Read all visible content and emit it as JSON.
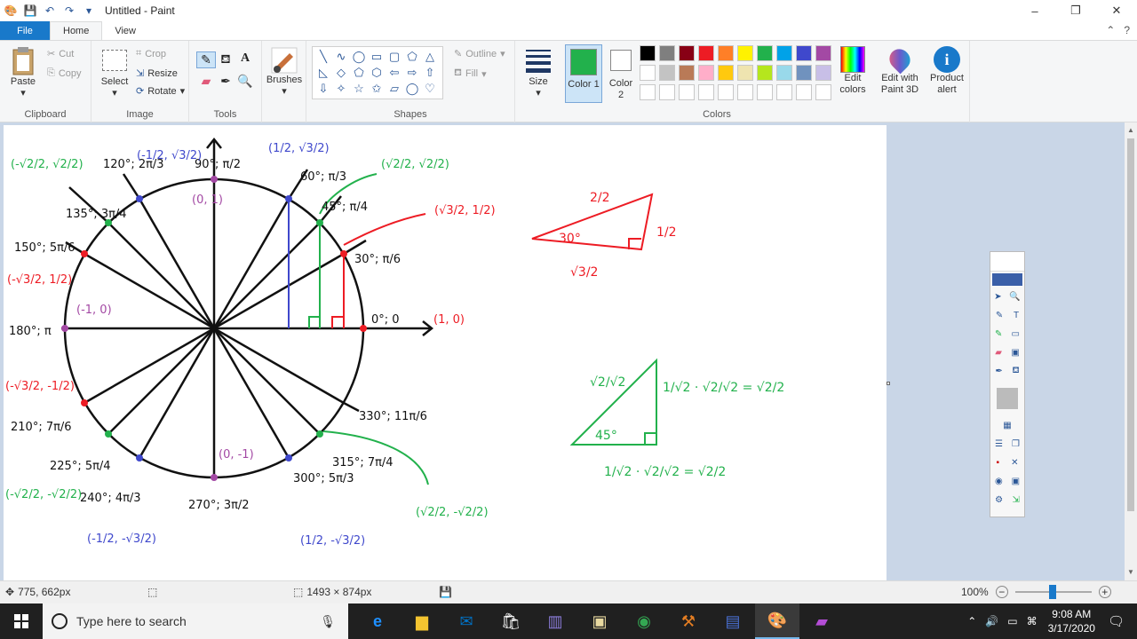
{
  "window": {
    "title": "Untitled - Paint",
    "min": "–",
    "max": "❐",
    "close": "✕"
  },
  "menu": {
    "file": "File",
    "home": "Home",
    "view": "View"
  },
  "ribbon": {
    "clipboard": {
      "label": "Clipboard",
      "paste": "Paste",
      "cut": "Cut",
      "copy": "Copy"
    },
    "image": {
      "label": "Image",
      "select": "Select",
      "crop": "Crop",
      "resize": "Resize",
      "rotate": "Rotate"
    },
    "tools": {
      "label": "Tools"
    },
    "brushes": {
      "label": "Brushes"
    },
    "shapes": {
      "label": "Shapes",
      "outline": "Outline",
      "fill": "Fill"
    },
    "size": {
      "label": "Size"
    },
    "colors": {
      "label": "Colors",
      "color1": "Color 1",
      "color2": "Color 2",
      "edit": "Edit colors",
      "paint3d": "Edit with Paint 3D",
      "alert": "Product alert"
    }
  },
  "palette": {
    "row1": [
      "#000000",
      "#7f7f7f",
      "#880015",
      "#ed1c24",
      "#ff7f27",
      "#fff200",
      "#22b14c",
      "#00a2e8",
      "#3f48cc",
      "#a349a4"
    ],
    "row2": [
      "#ffffff",
      "#c3c3c3",
      "#b97a57",
      "#ffaec9",
      "#ffc90e",
      "#efe4b0",
      "#b5e61d",
      "#99d9ea",
      "#7092be",
      "#c8bfe7"
    ],
    "color1": "#22b14c",
    "color2": "#ffffff"
  },
  "canvas": {
    "angles": {
      "a90": "90°; π/2",
      "a60": "60°; π/3",
      "a45": "45°; π/4",
      "a30": "30°; π/6",
      "a120": "120°; 2π/3",
      "a135": "135°; 3π/4",
      "a150": "150°; 5π/6",
      "a0": "0°; 0",
      "a180": "180°; π",
      "a210": "210°; 7π/6",
      "a225": "225°; 5π/4",
      "a240": "240°; 4π/3",
      "a270": "270°; 3π/2",
      "a300": "300°; 5π/3",
      "a315": "315°; 7π/4",
      "a330": "330°; 11π/6"
    },
    "coords": {
      "c90": "(0, 1)",
      "c60": "(1/2, √3/2)",
      "c45": "(√2/2, √2/2)",
      "c30": "(√3/2, 1/2)",
      "c120": "(-1/2, √3/2)",
      "c135": "(-√2/2, √2/2)",
      "c150": "(-√3/2, 1/2)",
      "c0": "(1, 0)",
      "c180": "(-1, 0)",
      "c210": "(-√3/2, -1/2)",
      "c225": "(-√2/2, -√2/2)",
      "c240": "(-1/2, -√3/2)",
      "c270": "(0, -1)",
      "c300": "(1/2, -√3/2)",
      "c315": "(√2/2, -√2/2)"
    },
    "notes": {
      "tri30_hyp": "2/2",
      "tri30_side": "1/2",
      "tri30_base": "√3/2",
      "tri30_angle": "30°",
      "tri45_hyp": "√2/√2",
      "tri45_angle": "45°",
      "eq1": "1/√2 · √2/√2 = √2/2",
      "eq2": "1/√2 · √2/√2 = √2/2"
    }
  },
  "status": {
    "cursor": "775, 662px",
    "size": "1493 × 874px",
    "zoom": "100%"
  },
  "taskbar": {
    "search": "Type here to search",
    "time": "9:08 AM",
    "date": "3/17/2020"
  }
}
